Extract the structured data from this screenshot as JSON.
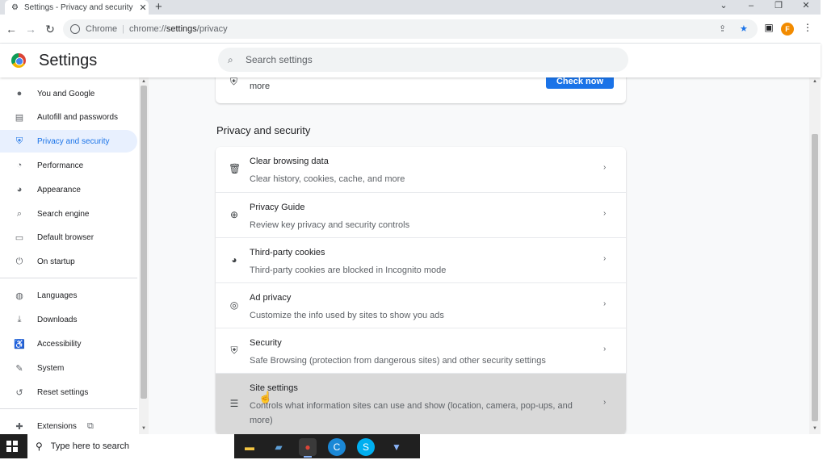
{
  "window": {
    "tab_title": "Settings - Privacy and security",
    "tab_close": "✕",
    "new_tab": "+",
    "controls": {
      "chevron": "⌄",
      "minimize": "–",
      "restore": "❐",
      "close": "✕"
    }
  },
  "toolbar": {
    "back": "←",
    "forward": "→",
    "reload": "↻",
    "chip": "Chrome",
    "separator": "|",
    "url_prefix": "chrome://",
    "url_path": "settings",
    "url_suffix": "/privacy",
    "share": "⇪",
    "bookmark": "★",
    "sidepanel": "▣",
    "profile_initial": "F",
    "menu": "⋮"
  },
  "header": {
    "app_title": "Settings",
    "search_placeholder": "Search settings",
    "search_glyph": "⌕"
  },
  "sidebar": {
    "items": [
      {
        "label": "You and Google",
        "icon": "person-icon",
        "glyph": "●"
      },
      {
        "label": "Autofill and passwords",
        "icon": "clipboard-icon",
        "glyph": "▤"
      },
      {
        "label": "Privacy and security",
        "icon": "shield-icon",
        "glyph": "⛨"
      },
      {
        "label": "Performance",
        "icon": "speedometer-icon",
        "glyph": "◔"
      },
      {
        "label": "Appearance",
        "icon": "palette-icon",
        "glyph": "◕"
      },
      {
        "label": "Search engine",
        "icon": "search-icon",
        "glyph": "⌕"
      },
      {
        "label": "Default browser",
        "icon": "browser-icon",
        "glyph": "▭"
      },
      {
        "label": "On startup",
        "icon": "power-icon",
        "glyph": "⏻"
      },
      {
        "label": "Languages",
        "icon": "globe-icon",
        "glyph": "◍"
      },
      {
        "label": "Downloads",
        "icon": "download-icon",
        "glyph": "⤓"
      },
      {
        "label": "Accessibility",
        "icon": "accessibility-icon",
        "glyph": "♿"
      },
      {
        "label": "System",
        "icon": "wrench-icon",
        "glyph": "✎"
      },
      {
        "label": "Reset settings",
        "icon": "reset-icon",
        "glyph": "↺"
      },
      {
        "label": "Extensions",
        "icon": "puzzle-icon",
        "glyph": "✚"
      }
    ],
    "active": "Privacy and security",
    "external_glyph": "⧉"
  },
  "main": {
    "safety_check": {
      "text": "Chrome can help keep you safe from data breaches, bad extensions, and more",
      "button": "Check now",
      "glyph": "⛨"
    },
    "section_title": "Privacy and security",
    "rows": [
      {
        "title": "Clear browsing data",
        "subtitle": "Clear history, cookies, cache, and more",
        "icon": "trash-icon",
        "glyph": "🗑"
      },
      {
        "title": "Privacy Guide",
        "subtitle": "Review key privacy and security controls",
        "icon": "compass-icon",
        "glyph": "⊕"
      },
      {
        "title": "Third-party cookies",
        "subtitle": "Third-party cookies are blocked in Incognito mode",
        "icon": "cookie-icon",
        "glyph": "◕"
      },
      {
        "title": "Ad privacy",
        "subtitle": "Customize the info used by sites to show you ads",
        "icon": "ad-privacy-icon",
        "glyph": "◎"
      },
      {
        "title": "Security",
        "subtitle": "Safe Browsing (protection from dangerous sites) and other security settings",
        "icon": "shield-icon",
        "glyph": "⛨"
      },
      {
        "title": "Site settings",
        "subtitle": "Controls what information sites can use and show (location, camera, pop-ups, and more)",
        "icon": "sliders-icon",
        "glyph": "☰"
      }
    ],
    "chevron": "›"
  },
  "taskbar": {
    "search_placeholder": "Type here to search",
    "search_glyph": "⚲",
    "apps": [
      {
        "name": "file-explorer-icon",
        "glyph": "▬",
        "color": "#f4c542"
      },
      {
        "name": "notepad-icon",
        "glyph": "▰",
        "color": "#5ea0d8"
      },
      {
        "name": "chrome-icon",
        "glyph": "●",
        "color": "#db4437"
      },
      {
        "name": "edge-icon",
        "glyph": "C",
        "color": "#1b88d6"
      },
      {
        "name": "skype-icon",
        "glyph": "S",
        "color": "#00aff0"
      },
      {
        "name": "installer-icon",
        "glyph": "▼",
        "color": "#3d7eb5"
      }
    ]
  },
  "colors": {
    "accent": "#1a73e8",
    "active_bg": "#e8f0fe",
    "hover_row": "#d9d9d9"
  }
}
